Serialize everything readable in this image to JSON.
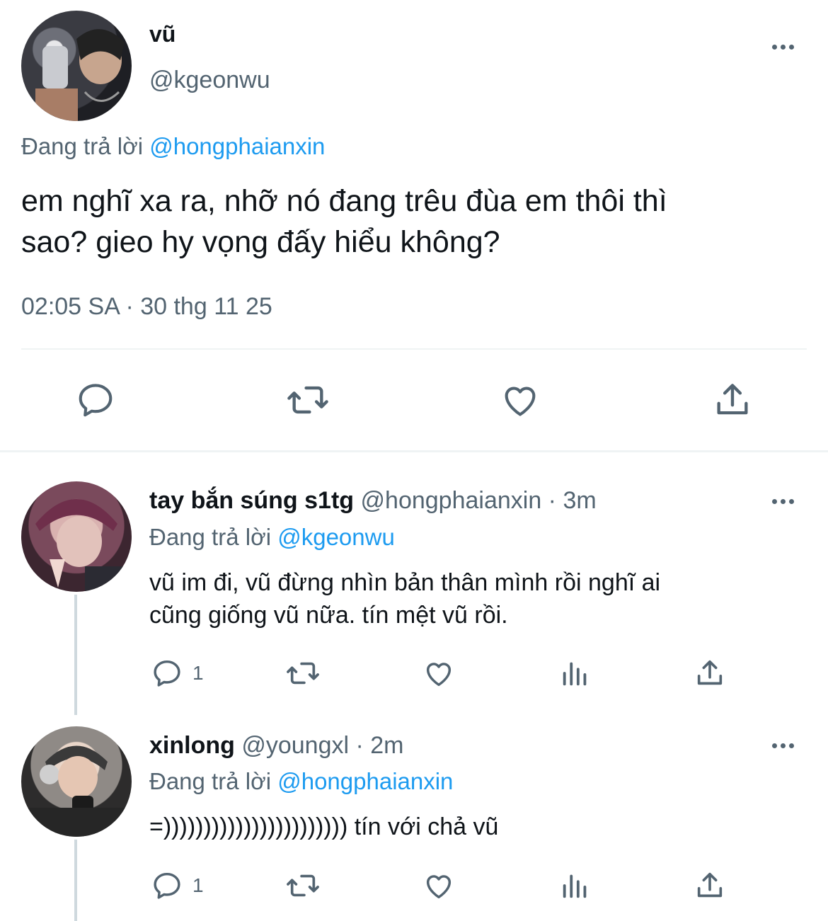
{
  "main_tweet": {
    "display_name": "vũ",
    "handle": "@kgeonwu",
    "reply_prefix": "Đang trả lời",
    "reply_to": "@hongphaianxin",
    "text_line1": "em nghĩ xa ra, nhỡ nó đang trêu đùa em thôi thì",
    "text_line2": "sao? gieo hy vọng đấy hiểu không?",
    "timestamp": "02:05 SA · 30 thg 11 25"
  },
  "replies": [
    {
      "display_name": "tay bắn súng s1tg",
      "handle": "@hongphaianxin",
      "time": " · 3m",
      "reply_prefix": "Đang trả lời",
      "reply_to": "@kgeonwu",
      "text_line1": "vũ im đi, vũ đừng nhìn bản thân mình rồi nghĩ ai",
      "text_line2": "cũng giống vũ nữa. tín mệt vũ rồi.",
      "reply_count": "1"
    },
    {
      "display_name": "xinlong",
      "handle": "@youngxl",
      "time": " · 2m",
      "reply_prefix": "Đang trả lời",
      "reply_to": "@hongphaianxin",
      "text_line1": "=))))))))))))))))))))))) tín với chả vũ",
      "reply_count": "1"
    }
  ],
  "icons": [
    "reply-icon",
    "retweet-icon",
    "like-icon",
    "share-icon",
    "views-icon",
    "more-icon"
  ],
  "colors": {
    "link": "#1d9bf0",
    "muted": "#536471",
    "text": "#0f1419",
    "divider": "#eff3f4"
  }
}
